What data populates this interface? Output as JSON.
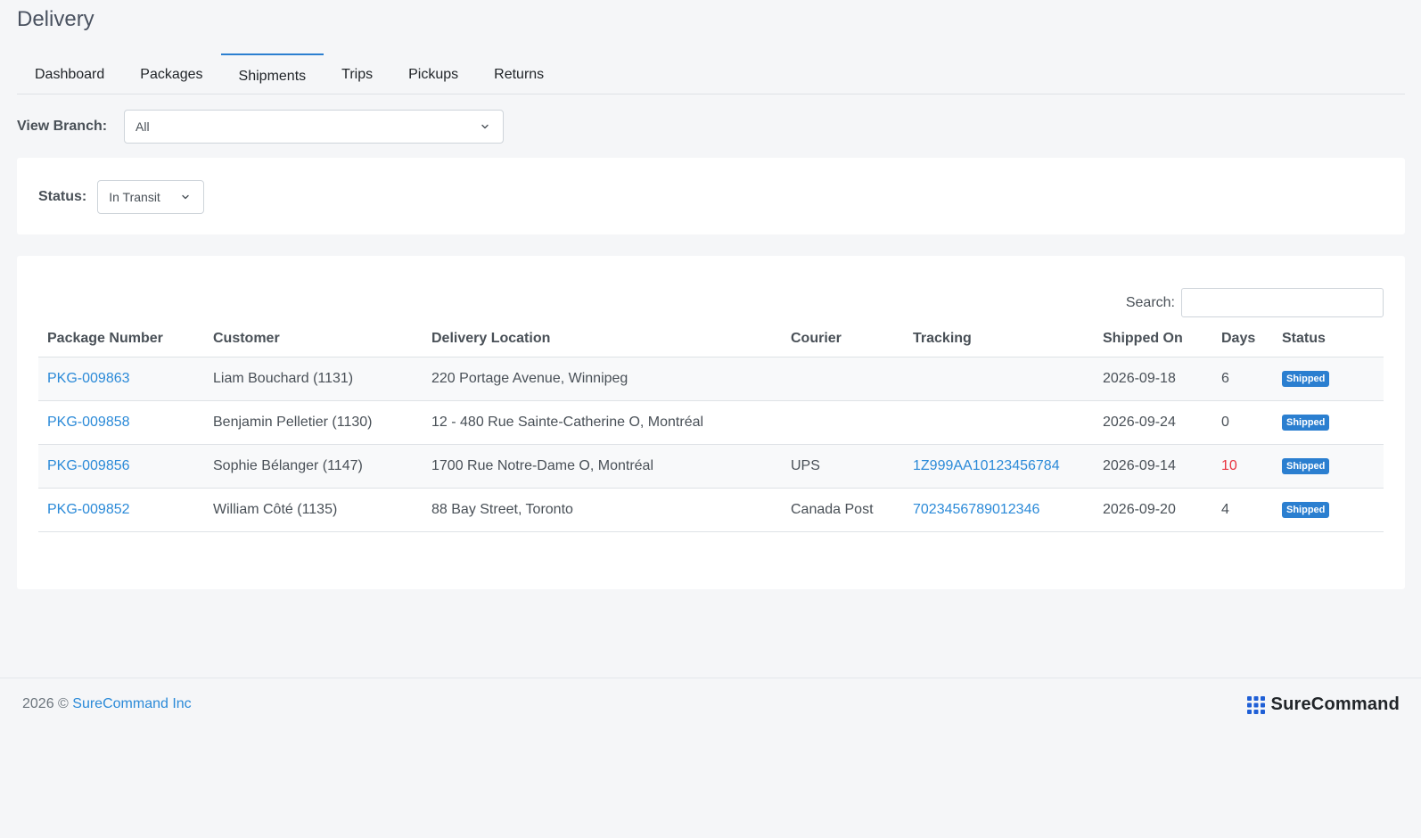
{
  "page": {
    "title": "Delivery"
  },
  "tabs": [
    {
      "label": "Dashboard",
      "active": false
    },
    {
      "label": "Packages",
      "active": false
    },
    {
      "label": "Shipments",
      "active": true
    },
    {
      "label": "Trips",
      "active": false
    },
    {
      "label": "Pickups",
      "active": false
    },
    {
      "label": "Returns",
      "active": false
    }
  ],
  "branch_filter": {
    "label": "View Branch:",
    "value": "All"
  },
  "status_filter": {
    "label": "Status:",
    "value": "In Transit"
  },
  "search": {
    "label": "Search:",
    "value": ""
  },
  "table": {
    "columns": [
      "Package Number",
      "Customer",
      "Delivery Location",
      "Courier",
      "Tracking",
      "Shipped On",
      "Days",
      "Status"
    ],
    "rows": [
      {
        "package": "PKG-009863",
        "customer": "Liam Bouchard (1131)",
        "location": "220 Portage Avenue, Winnipeg",
        "courier": "",
        "tracking": "",
        "shipped_on": "2026-09-18",
        "days": "6",
        "status": "Shipped"
      },
      {
        "package": "PKG-009858",
        "customer": "Benjamin Pelletier (1130)",
        "location": "12 - 480 Rue Sainte-Catherine O, Montréal",
        "courier": "",
        "tracking": "",
        "shipped_on": "2026-09-24",
        "days": "0",
        "status": "Shipped"
      },
      {
        "package": "PKG-009856",
        "customer": "Sophie Bélanger (1147)",
        "location": "1700 Rue Notre-Dame O, Montréal",
        "courier": "UPS",
        "tracking": "1Z999AA10123456784",
        "shipped_on": "2026-09-14",
        "days": "10",
        "status": "Shipped"
      },
      {
        "package": "PKG-009852",
        "customer": "William Côté (1135)",
        "location": "88 Bay Street, Toronto",
        "courier": "Canada Post",
        "tracking": "7023456789012346",
        "shipped_on": "2026-09-20",
        "days": "4",
        "status": "Shipped"
      }
    ]
  },
  "footer": {
    "year_prefix": "2026 ©",
    "company_link": "SureCommand Inc",
    "brand_name": "SureCommand"
  },
  "colors": {
    "accent": "#2b7fd0",
    "link": "#2b8ad8",
    "late_days": "#e8333f",
    "brand_logo": "#1f5fd6"
  },
  "icons": {
    "select_chevron": "chevron-down-icon",
    "brand_logo": "grid-dots-icon"
  }
}
